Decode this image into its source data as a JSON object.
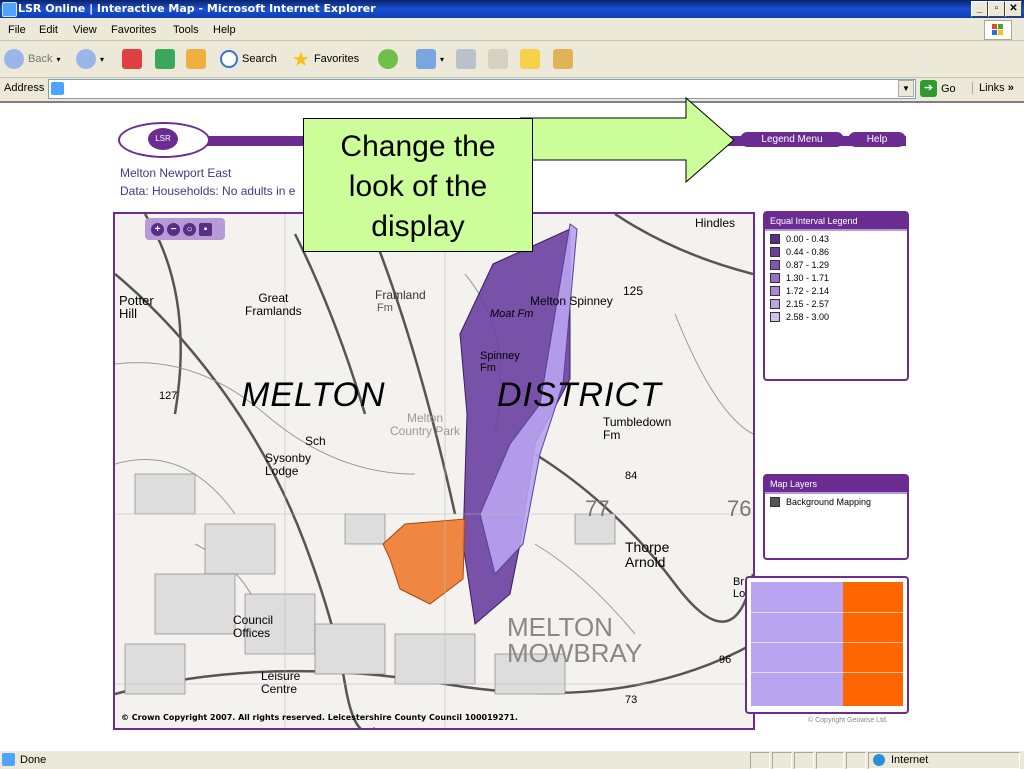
{
  "window": {
    "title": "LSR Online | Interactive Map - Microsoft Internet Explorer"
  },
  "menu": [
    "File",
    "Edit",
    "View",
    "Favorites",
    "Tools",
    "Help"
  ],
  "toolbar": {
    "back": "Back",
    "search": "Search",
    "favorites": "Favorites"
  },
  "address": {
    "label": "Address",
    "go": "Go",
    "links": "Links"
  },
  "status": {
    "left": "Done",
    "zone": "Internet"
  },
  "site": {
    "logo": "LSR",
    "nav": [
      "Legend Menu",
      "Help"
    ],
    "area": "Melton Newport East",
    "data_line": "Data: Households: No adults in e"
  },
  "callout": {
    "line1": "Change the",
    "line2": "look of the",
    "line3": "display"
  },
  "map": {
    "labels": {
      "potter_hill": "Potter\nHill",
      "great_framlands": "Great\nFramlands",
      "framland": "Framland",
      "fm": "Fm",
      "hindles": "Hindles",
      "melton_spinney": "Melton Spinney",
      "moat_fm": "Moat Fm",
      "spinney_fm": "Spinney\nFm",
      "melton": "MELTON",
      "district": "DISTRICT",
      "tumbledown": "Tumbledown\nFm",
      "melton_country_park": "Melton\nCountry Park",
      "sch": "Sch",
      "sysonby": "Sysonby\nLodge",
      "n127": "127",
      "n125": "125",
      "n84": "84",
      "n77": "77",
      "n76": "76",
      "n96": "96",
      "n73": "73",
      "thorpe_arnold": "Thorpe\nArnold",
      "melton_mowbray": "MELTON\nMOWBRAY",
      "council_offices": "Council\nOffices",
      "leisure_centre": "Leisure\nCentre",
      "br": "Br\nLo"
    },
    "copyright": "© Crown Copyright 2007. All rights reserved. Leicestershire County Council 100019271.",
    "colors": {
      "dark_purple": "#6a3fa0",
      "light_purple": "#b8a4f0",
      "orange": "#ee7a2e"
    }
  },
  "legend": {
    "title": "Equal Interval Legend",
    "items": [
      {
        "label": "0.00 - 0.43",
        "color": "#5a2d88"
      },
      {
        "label": "0.44 - 0.86",
        "color": "#6f3f9d"
      },
      {
        "label": "0.87 - 1.29",
        "color": "#8356b0"
      },
      {
        "label": "1.30 - 1.71",
        "color": "#9670c2"
      },
      {
        "label": "1.72 - 2.14",
        "color": "#a98ad2"
      },
      {
        "label": "2.15 - 2.57",
        "color": "#bba5e0"
      },
      {
        "label": "2.58 - 3.00",
        "color": "#cdbfee"
      }
    ]
  },
  "layers": {
    "title": "Map Layers",
    "items": [
      "Background Mapping"
    ]
  },
  "footer": {
    "copyright": "© Copyright Geowise Ltd."
  }
}
